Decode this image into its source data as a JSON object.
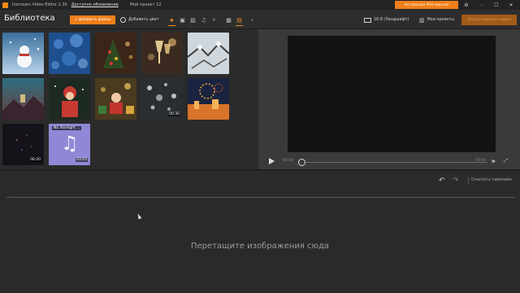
{
  "titlebar": {
    "app_name": "Icecream Video Editor 2.30",
    "update_link": "Доступно обновление",
    "project_name": "Мой проект 12",
    "pro_button": "Активация PRO-версии",
    "settings_icon": "gear-icon",
    "minimize_icon": "minimize-icon",
    "maximize_icon": "maximize-icon",
    "close_icon": "close-icon"
  },
  "toolbar": {
    "library_title": "Библиотека",
    "add_files": "+ Добавить файлы",
    "add_color": "Добавить цвет",
    "filters": [
      {
        "icon": "star-icon",
        "active": true
      },
      {
        "icon": "video-icon",
        "active": false
      },
      {
        "icon": "image-icon",
        "active": false
      },
      {
        "icon": "music-icon",
        "active": false
      },
      {
        "icon": "search-icon",
        "active": false
      }
    ],
    "view_modes": [
      {
        "icon": "grid-small-icon",
        "active": false
      },
      {
        "icon": "grid-large-icon",
        "active": true
      }
    ],
    "collapse_icon": "chevron-left-icon",
    "aspect_ratio": "16:9 (Ландшафт)",
    "my_projects": "Мои проекты",
    "export": "Экспортировать видео"
  },
  "library": {
    "items": [
      {
        "kind": "image",
        "subject": "snowman"
      },
      {
        "kind": "image",
        "subject": "blue bokeh"
      },
      {
        "kind": "image",
        "subject": "christmas tree"
      },
      {
        "kind": "image",
        "subject": "champagne"
      },
      {
        "kind": "image",
        "subject": "snowy branches"
      },
      {
        "kind": "image",
        "subject": "winter landscape"
      },
      {
        "kind": "image",
        "subject": "girl in snow"
      },
      {
        "kind": "image",
        "subject": "child with gifts"
      },
      {
        "kind": "video",
        "subject": "snowflakes",
        "duration": "00:30"
      },
      {
        "kind": "image",
        "subject": "fireworks"
      },
      {
        "kind": "video",
        "subject": "dark sparkles",
        "duration": "00:20"
      },
      {
        "kind": "audio",
        "title": "No Starlight ...",
        "duration": "03:03"
      }
    ]
  },
  "player": {
    "current_time": "00:00",
    "total_time": "00:00",
    "position": 0,
    "play_icon": "play-icon",
    "volume_icon": "volume-icon",
    "fullscreen_icon": "fullscreen-icon"
  },
  "timeline": {
    "undo_icon": "undo-icon",
    "redo_icon": "redo-icon",
    "clear": "Очистить таймлайн",
    "drop_hint": "Перетащите изображения сюда"
  },
  "colors": {
    "accent": "#ef7f1a",
    "background": "#2b2b2b",
    "preview_bg": "#3a3a3a",
    "screen": "#121212"
  }
}
